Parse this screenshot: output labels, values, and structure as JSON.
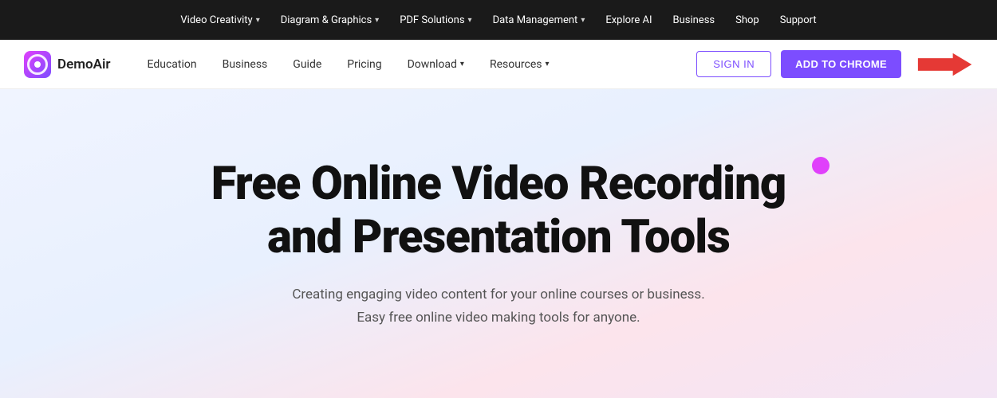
{
  "topNav": {
    "items": [
      {
        "label": "Video Creativity",
        "hasDropdown": true
      },
      {
        "label": "Diagram & Graphics",
        "hasDropdown": true
      },
      {
        "label": "PDF Solutions",
        "hasDropdown": true
      },
      {
        "label": "Data Management",
        "hasDropdown": true
      },
      {
        "label": "Explore AI",
        "hasDropdown": false
      },
      {
        "label": "Business",
        "hasDropdown": false
      },
      {
        "label": "Shop",
        "hasDropdown": false
      },
      {
        "label": "Support",
        "hasDropdown": false
      }
    ]
  },
  "secondaryNav": {
    "logoText": "DemoAir",
    "links": [
      {
        "label": "Education",
        "hasDropdown": false
      },
      {
        "label": "Business",
        "hasDropdown": false
      },
      {
        "label": "Guide",
        "hasDropdown": false
      },
      {
        "label": "Pricing",
        "hasDropdown": false
      },
      {
        "label": "Download",
        "hasDropdown": true
      },
      {
        "label": "Resources",
        "hasDropdown": true
      }
    ],
    "signInLabel": "SIGN IN",
    "addChromeLabel": "ADD TO CHROME"
  },
  "hero": {
    "titleLine1": "Free Online Video Recording",
    "titleLine2": "and Presentation Tools",
    "subtitle1": "Creating engaging video content for your online courses or business.",
    "subtitle2": "Easy free online video making tools for anyone."
  }
}
